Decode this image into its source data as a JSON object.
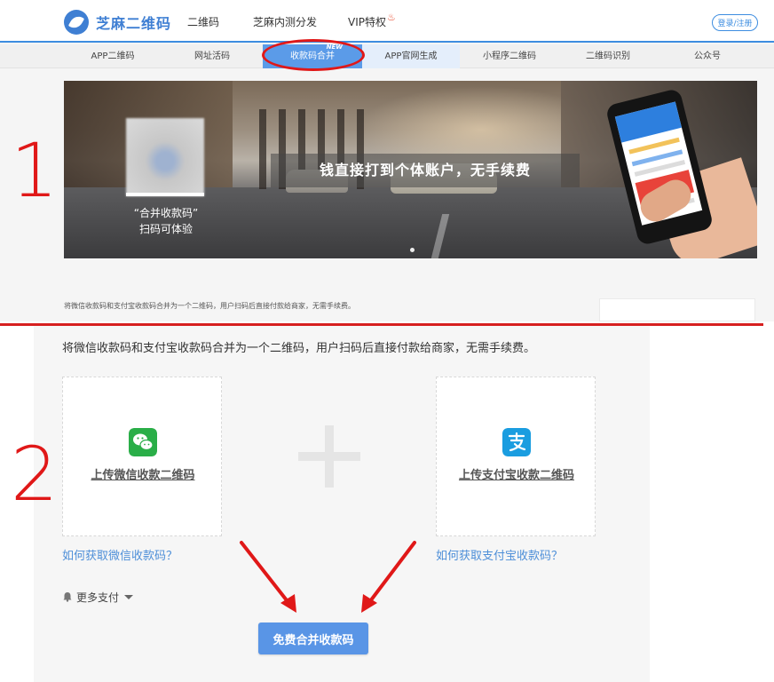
{
  "header": {
    "logo_text": "芝麻二维码",
    "nav": [
      "二维码",
      "芝麻内测分发",
      "VIP特权"
    ],
    "login_label": "登录/注册"
  },
  "subnav": {
    "items": [
      "APP二维码",
      "网址活码",
      "收款码合并",
      "APP官网生成",
      "小程序二维码",
      "二维码识别",
      "公众号"
    ],
    "badge": "NEW"
  },
  "banner": {
    "caption_1": "“合并收款码”",
    "caption_2": "扫码可体验",
    "slogan": "钱直接打到个体账户，无手续费"
  },
  "top_description": "将微信收款码和支付宝收款码合并为一个二维码，用户扫码后直接付款给商家，无需手续费。",
  "annotations": {
    "step_1": "1",
    "step_2": "2"
  },
  "merge_form": {
    "intro": "将微信收款码和支付宝收款码合并为一个二维码，用户扫码后直接付款给商家，无需手续费。",
    "wechat_upload_label": "上传微信收款二维码",
    "alipay_upload_label": "上传支付宝收款二维码",
    "wechat_help": "如何获取微信收款码？",
    "alipay_help": "如何获取支付宝收款码？",
    "more_pay_label": "更多支付",
    "submit_label": "免费合并收款码"
  },
  "icons": {
    "wechat": "wechat-icon",
    "alipay": "alipay-icon",
    "plus": "plus-icon",
    "bell": "bell-icon",
    "chevron": "chevron-down-icon"
  },
  "colors": {
    "primary": "#5b9be8",
    "annotation_red": "#e01818",
    "link_blue": "#4e8fd8",
    "wechat_green": "#2aae48",
    "alipay_blue": "#1a9de0"
  }
}
